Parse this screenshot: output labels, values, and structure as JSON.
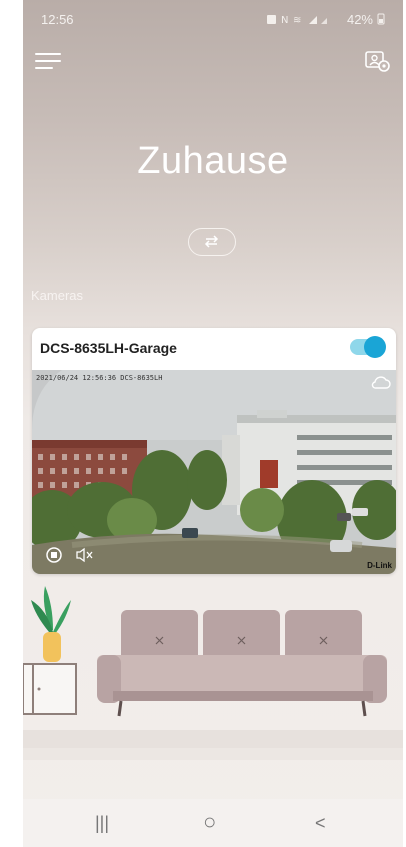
{
  "status_bar": {
    "time": "12:56",
    "indicators": "  • ⟪ ≡ .∥ 42%",
    "battery": "42%"
  },
  "header": {
    "menu_icon": "hamburger-menu-icon",
    "camera_settings_icon": "camera-settings-icon"
  },
  "main": {
    "title": "Zuhause",
    "switch_icon": "swap-arrows-icon",
    "section_label": "Kameras"
  },
  "camera_card": {
    "name": "DCS-8635LH-Garage",
    "enabled": true,
    "osd_text": "2021/06/24 12:56:36 DCS-8635LH",
    "brand": "D-Link",
    "controls": [
      "stop-icon",
      "mute-icon"
    ],
    "cloud_icon": "cloud-icon"
  },
  "nav_bar": {
    "recent": "|||",
    "home": "○",
    "back": "<"
  },
  "colors": {
    "accent": "#1aa5d6",
    "toggle_track": "#8fd7ea",
    "sofa": "#b8a3a3",
    "plant": "#3aa060",
    "pot": "#f2c25c"
  }
}
